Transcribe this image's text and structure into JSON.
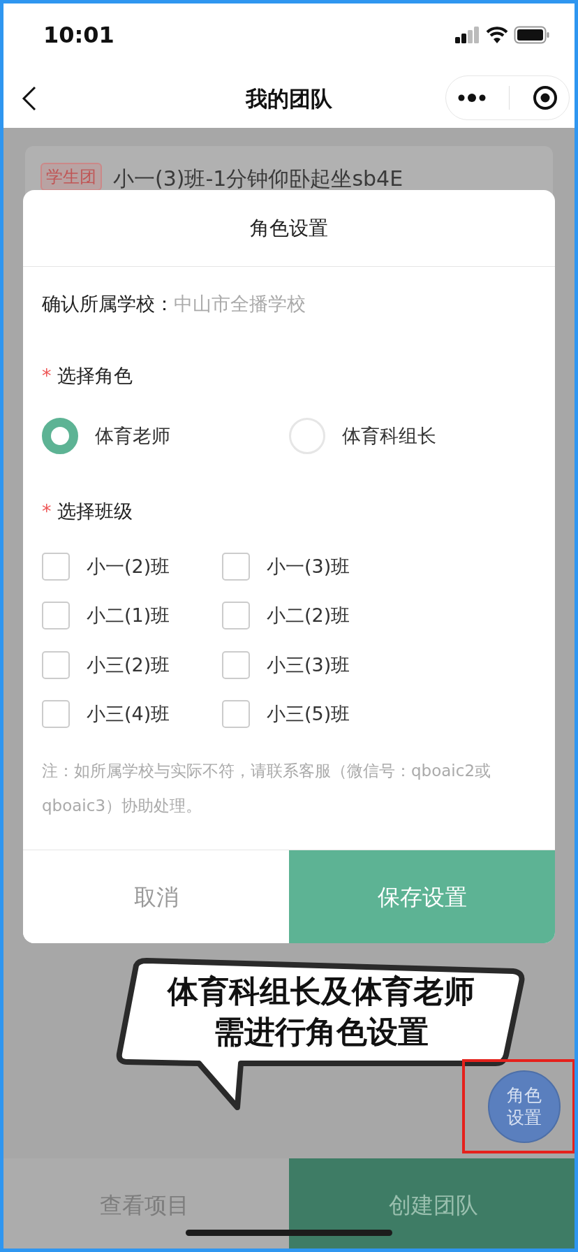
{
  "status_bar": {
    "time": "10:01"
  },
  "nav": {
    "title": "我的团队"
  },
  "background_card": {
    "tag": "学生团",
    "title": "小一(3)班-1分钟仰卧起坐sb4E"
  },
  "dialog": {
    "title": "角色设置",
    "school_label": "确认所属学校：",
    "school_value": "中山市全播学校",
    "role_section": {
      "marker": "*",
      "label": "选择角色"
    },
    "roles": [
      {
        "label": "体育老师",
        "selected": true
      },
      {
        "label": "体育科组长",
        "selected": false
      }
    ],
    "class_section": {
      "marker": "*",
      "label": "选择班级"
    },
    "classes": [
      {
        "label": "小一(2)班",
        "checked": false
      },
      {
        "label": "小一(3)班",
        "checked": false
      },
      {
        "label": "小二(1)班",
        "checked": false
      },
      {
        "label": "小二(2)班",
        "checked": false
      },
      {
        "label": "小三(2)班",
        "checked": false
      },
      {
        "label": "小三(3)班",
        "checked": false
      },
      {
        "label": "小三(4)班",
        "checked": false
      },
      {
        "label": "小三(5)班",
        "checked": false
      }
    ],
    "note": "注：如所属学校与实际不符，请联系客服（微信号：qboaic2或qboaic3）协助处理。",
    "buttons": [
      {
        "label": "取消",
        "kind": "cancel"
      },
      {
        "label": "保存设置",
        "kind": "primary"
      }
    ]
  },
  "callout": {
    "lines": [
      "体育科组长及体育老师",
      "需进行角色设置"
    ]
  },
  "fab": {
    "label": "角色设置"
  },
  "bottom_bar": [
    {
      "label": "查看项目",
      "kind": "secondary"
    },
    {
      "label": "创建团队",
      "kind": "primary"
    }
  ]
}
